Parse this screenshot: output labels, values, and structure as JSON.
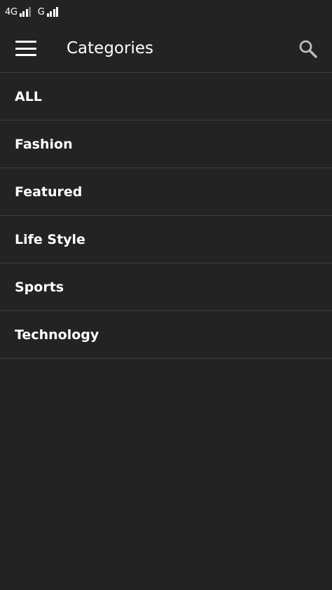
{
  "status_bar": {
    "network1": "4G",
    "network2": "G"
  },
  "app_bar": {
    "title": "Categories",
    "menu_icon": "hamburger-menu-icon",
    "search_icon": "search-icon"
  },
  "categories": [
    {
      "label": "ALL"
    },
    {
      "label": "Fashion"
    },
    {
      "label": "Featured"
    },
    {
      "label": "Life Style"
    },
    {
      "label": "Sports"
    },
    {
      "label": "Technology"
    }
  ],
  "colors": {
    "background": "#232323",
    "divider": "#3c3c3c",
    "text": "#ffffff"
  }
}
